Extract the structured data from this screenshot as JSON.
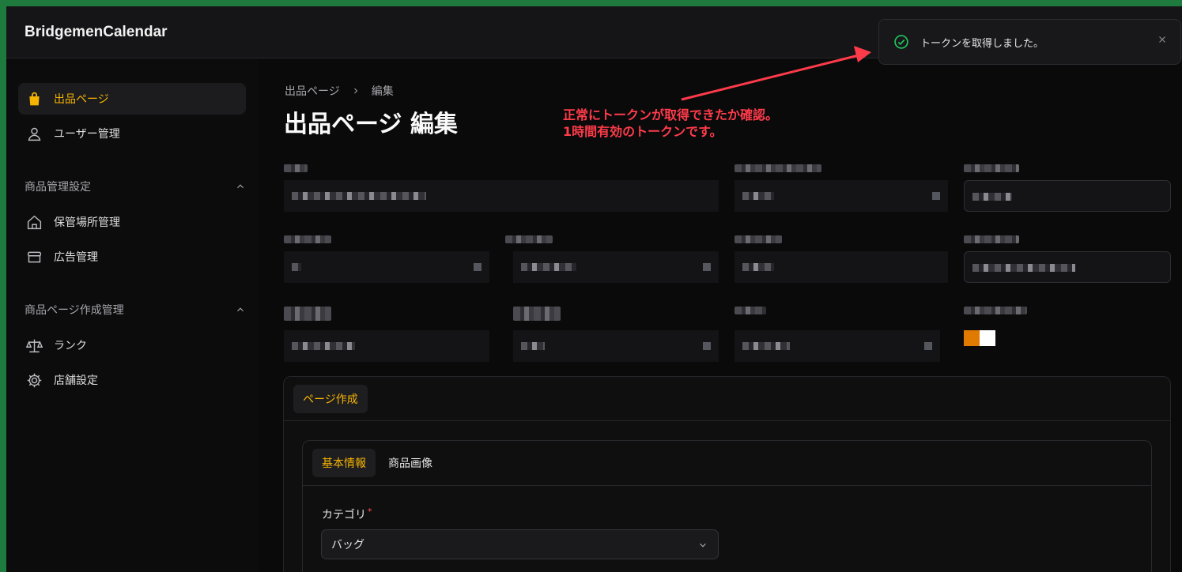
{
  "app": {
    "title": "BridgemenCalendar"
  },
  "sidebar": {
    "items": [
      {
        "label": "出品ページ",
        "icon": "shopping-bag-icon",
        "active": true
      },
      {
        "label": "ユーザー管理",
        "icon": "user-icon"
      }
    ],
    "sections": [
      {
        "title": "商品管理設定",
        "items": [
          {
            "label": "保管場所管理",
            "icon": "home-icon"
          },
          {
            "label": "広告管理",
            "icon": "archive-icon"
          }
        ]
      },
      {
        "title": "商品ページ作成管理",
        "items": [
          {
            "label": "ランク",
            "icon": "scale-icon"
          },
          {
            "label": "店舗設定",
            "icon": "gear-icon"
          }
        ]
      }
    ]
  },
  "breadcrumb": {
    "parent": "出品ページ",
    "current": "編集"
  },
  "page": {
    "title": "出品ページ 編集"
  },
  "annotation": {
    "line1": "正常にトークンが取得できたか確認。",
    "line2": "1時間有効のトークンです。"
  },
  "toast": {
    "message": "トークンを取得しました。"
  },
  "tabs": {
    "outer": [
      "ページ作成"
    ],
    "inner": [
      "基本情報",
      "商品画像"
    ]
  },
  "form": {
    "category_label": "カテゴリ",
    "required_mark": "*",
    "category_value": "バッグ"
  },
  "colors": {
    "accent": "#f5b400",
    "success": "#22c55e",
    "annotation": "#ff3b4a",
    "swatch_orange": "#e07a00",
    "swatch_white": "#ffffff"
  }
}
